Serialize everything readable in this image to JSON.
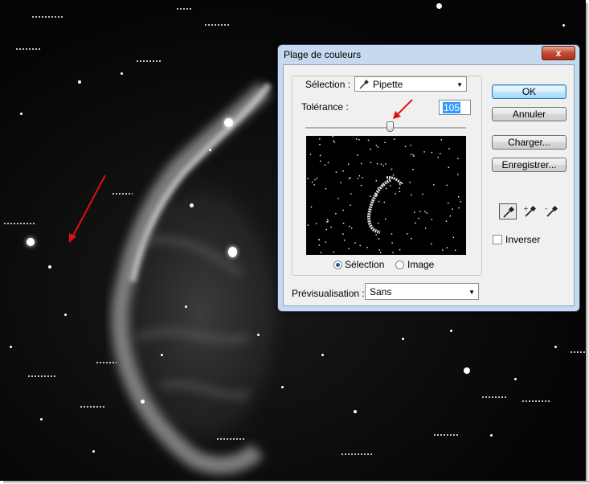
{
  "dialog": {
    "title": "Plage de couleurs",
    "close_label": "x",
    "selection_label": "Sélection :",
    "selection_value": "Pipette",
    "tolerance_label": "Tolérance :",
    "tolerance_value": "105",
    "tolerance_level_fraction": 0.52,
    "radio_selection_label": "Sélection",
    "radio_image_label": "Image",
    "preview_label": "Prévisualisation :",
    "preview_value": "Sans",
    "buttons": {
      "ok": "OK",
      "cancel": "Annuler",
      "load": "Charger...",
      "save": "Enregistrer..."
    },
    "invert_label": "Inverser"
  },
  "annotation_color": "#e01010",
  "icons": [
    "eyedropper-icon",
    "eyedropper-plus-icon",
    "eyedropper-minus-icon"
  ]
}
